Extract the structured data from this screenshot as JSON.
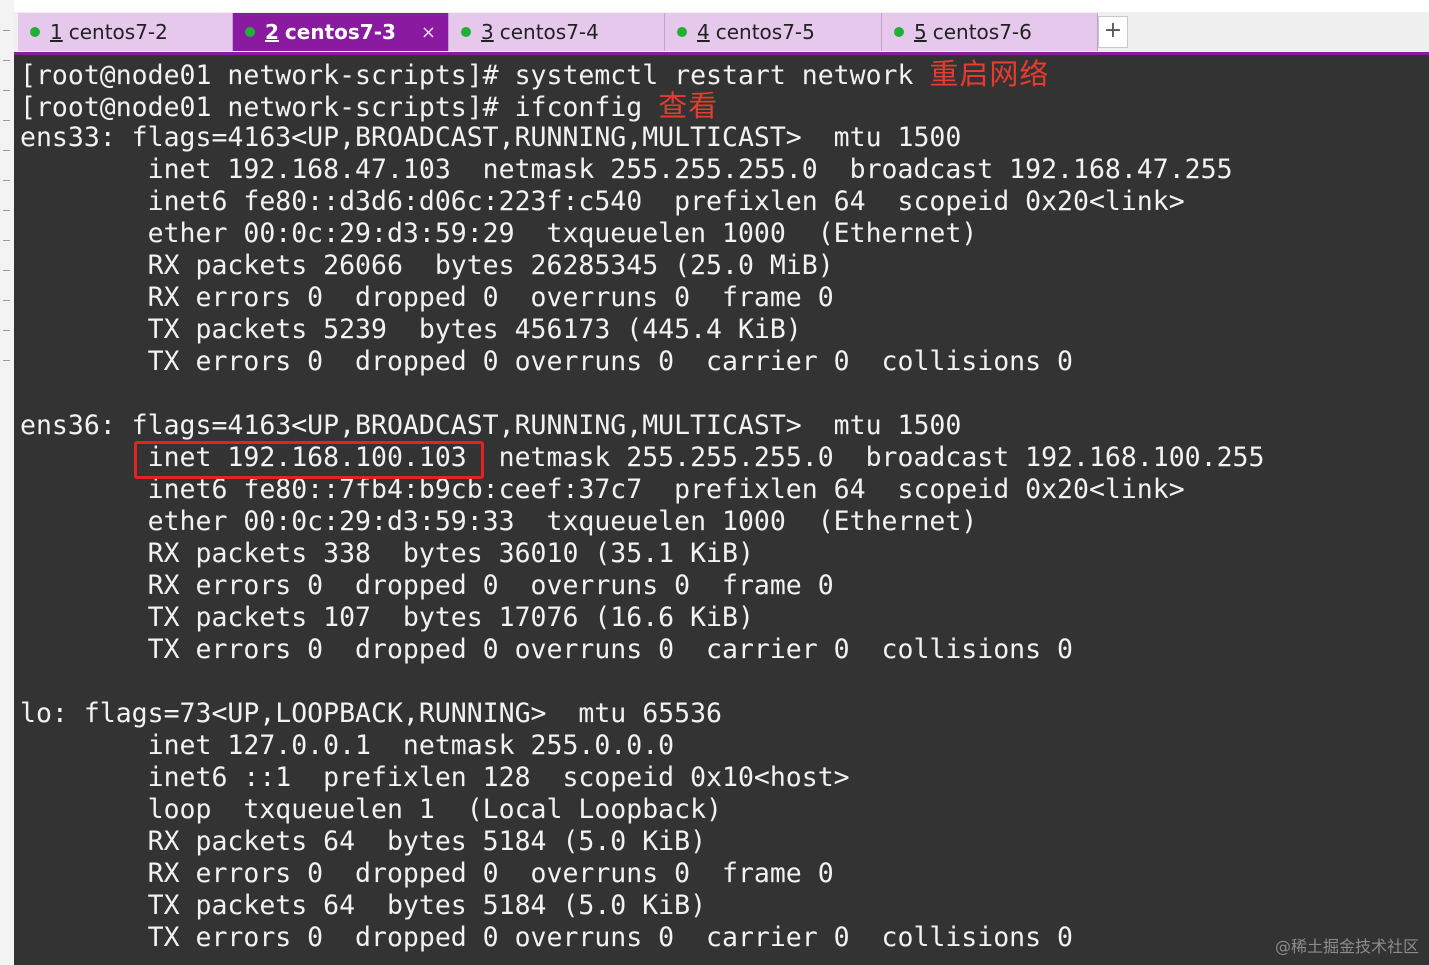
{
  "tabs": [
    {
      "index": "1",
      "name": "centos7-2",
      "active": false
    },
    {
      "index": "2",
      "name": "centos7-3",
      "active": true,
      "close": "×"
    },
    {
      "index": "3",
      "name": "centos7-4",
      "active": false
    },
    {
      "index": "4",
      "name": "centos7-5",
      "active": false
    },
    {
      "index": "5",
      "name": "centos7-6",
      "active": false
    }
  ],
  "new_tab_label": "+",
  "terminal": {
    "lines": [
      {
        "text": "[root@node01 network-scripts]# systemctl restart network ",
        "note": "重启网络"
      },
      {
        "text": "[root@node01 network-scripts]# ifconfig ",
        "note": "查看"
      },
      {
        "text": "ens33: flags=4163<UP,BROADCAST,RUNNING,MULTICAST>  mtu 1500"
      },
      {
        "text": "        inet 192.168.47.103  netmask 255.255.255.0  broadcast 192.168.47.255"
      },
      {
        "text": "        inet6 fe80::d3d6:d06c:223f:c540  prefixlen 64  scopeid 0x20<link>"
      },
      {
        "text": "        ether 00:0c:29:d3:59:29  txqueuelen 1000  (Ethernet)"
      },
      {
        "text": "        RX packets 26066  bytes 26285345 (25.0 MiB)"
      },
      {
        "text": "        RX errors 0  dropped 0  overruns 0  frame 0"
      },
      {
        "text": "        TX packets 5239  bytes 456173 (445.4 KiB)"
      },
      {
        "text": "        TX errors 0  dropped 0 overruns 0  carrier 0  collisions 0"
      },
      {
        "text": ""
      },
      {
        "text": "ens36: flags=4163<UP,BROADCAST,RUNNING,MULTICAST>  mtu 1500"
      },
      {
        "text": "        inet 192.168.100.103  netmask 255.255.255.0  broadcast 192.168.100.255",
        "highlight": "inet 192.168.100.103"
      },
      {
        "text": "        inet6 fe80::7fb4:b9cb:ceef:37c7  prefixlen 64  scopeid 0x20<link>"
      },
      {
        "text": "        ether 00:0c:29:d3:59:33  txqueuelen 1000  (Ethernet)"
      },
      {
        "text": "        RX packets 338  bytes 36010 (35.1 KiB)"
      },
      {
        "text": "        RX errors 0  dropped 0  overruns 0  frame 0"
      },
      {
        "text": "        TX packets 107  bytes 17076 (16.6 KiB)"
      },
      {
        "text": "        TX errors 0  dropped 0 overruns 0  carrier 0  collisions 0"
      },
      {
        "text": ""
      },
      {
        "text": "lo: flags=73<UP,LOOPBACK,RUNNING>  mtu 65536"
      },
      {
        "text": "        inet 127.0.0.1  netmask 255.0.0.0"
      },
      {
        "text": "        inet6 ::1  prefixlen 128  scopeid 0x10<host>"
      },
      {
        "text": "        loop  txqueuelen 1  (Local Loopback)"
      },
      {
        "text": "        RX packets 64  bytes 5184 (5.0 KiB)"
      },
      {
        "text": "        RX errors 0  dropped 0  overruns 0  frame 0"
      },
      {
        "text": "        TX packets 64  bytes 5184 (5.0 KiB)"
      },
      {
        "text": "        TX errors 0  dropped 0 overruns 0  carrier 0  collisions 0"
      }
    ]
  },
  "watermark": "@稀土掘金技术社区",
  "colors": {
    "terminal_bg": "#333333",
    "terminal_fg": "#f2f2f2",
    "annotation": "#e83b30",
    "highlight_box": "#e32222",
    "active_tab": "#8a1aa0",
    "inactive_tab": "#e5c8ec",
    "status_dot": "#21b035"
  }
}
